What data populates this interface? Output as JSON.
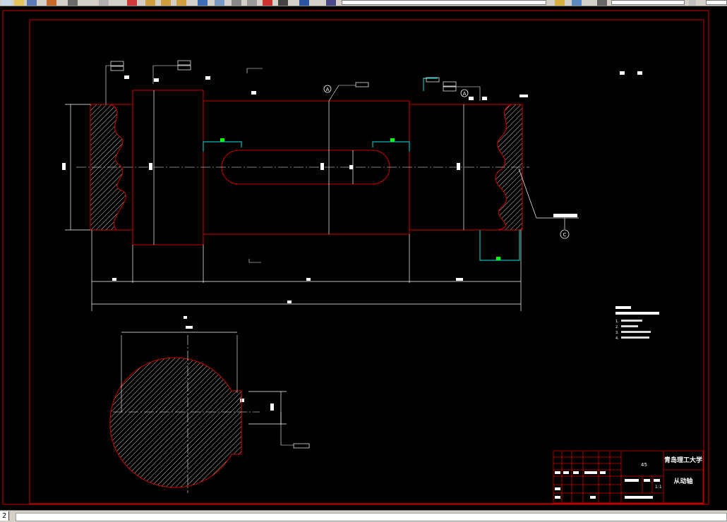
{
  "toolbar": {
    "layer_combo": "",
    "style_combo": "",
    "buttons": [
      "new-icon",
      "open-icon",
      "save-icon",
      "print-icon",
      "undo-icon",
      "redo-icon",
      "pan-icon",
      "zoom-realtime-icon",
      "zoom-window-icon",
      "zoom-previous-icon",
      "properties-icon",
      "design-center-icon",
      "tool-palette-icon",
      "calc-icon",
      "help-icon",
      "layer-icon",
      "match-prop-icon"
    ]
  },
  "drawing": {
    "colors": {
      "background": "#000000",
      "frame": "#cc0000",
      "outline": "#cc0000",
      "dim": "#ffffff",
      "center": "#ffffff",
      "hatch": "#ffffff",
      "cyan": "#00e5e5",
      "green": "#00ff00"
    },
    "datum_a": "A",
    "datum_c": "C",
    "tech_req_lines": [
      "1.",
      "2.",
      "3.",
      "4."
    ],
    "title_block": {
      "school": "青岛理工大学",
      "part_name": "从动轴",
      "material": "45",
      "scale": "1:1",
      "sheet": "共 1 张   第 1 张",
      "rows": [
        "标记",
        "处数",
        "分区",
        "更改文件号",
        "签名",
        "年月日",
        "设计",
        "标准化",
        "阶段标记",
        "重量",
        "比例",
        "审核",
        "工艺",
        "批准"
      ]
    }
  },
  "tabs": {
    "active_label": "2"
  }
}
